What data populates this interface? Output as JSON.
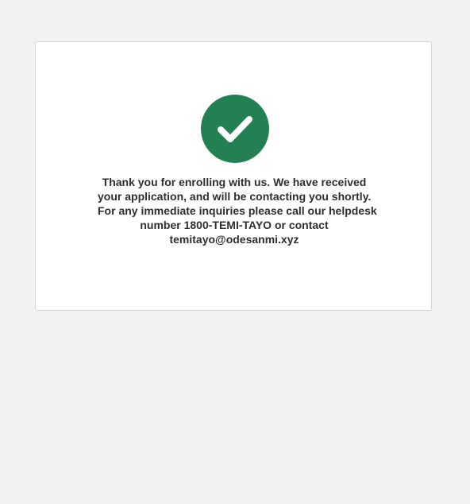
{
  "colors": {
    "page_background": "#f2f2f2",
    "card_background": "#ffffff",
    "success_green": "#228052",
    "text": "#2e2e2e"
  },
  "status_icon": "checkmark-icon",
  "confirmation": {
    "lines": [
      "Thank you for enrolling with us. We have received",
      "your application, and will be contacting you shortly.",
      "For any immediate inquiries please call our helpdesk",
      "number 1800-TEMI-TAYO or contact",
      "temitayo@odesanmi.xyz"
    ]
  }
}
